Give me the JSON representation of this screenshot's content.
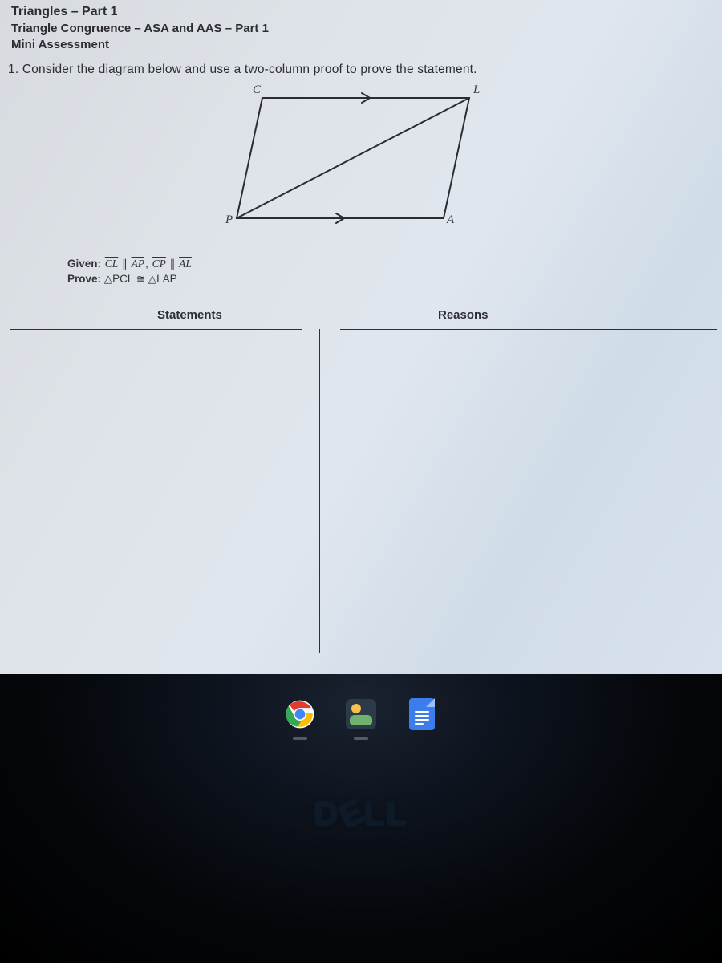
{
  "header": {
    "title": "Triangles – Part 1",
    "subtitle": "Triangle Congruence – ASA and AAS – Part 1",
    "assessment": "Mini Assessment"
  },
  "question": {
    "number": "1.",
    "text": "Consider the diagram below and use a two-column proof to prove the statement."
  },
  "diagram": {
    "vertices": {
      "C": "C",
      "L": "L",
      "P": "P",
      "A": "A"
    }
  },
  "proof_setup": {
    "given_label": "Given:",
    "given_seg1a": "CL",
    "given_rel1": " ∥ ",
    "given_seg1b": "AP",
    "given_sep": ", ",
    "given_seg2a": "CP",
    "given_rel2": " ∥ ",
    "given_seg2b": "AL",
    "prove_label": "Prove:",
    "prove_text_pre": " △PCL ≅ △LAP"
  },
  "table": {
    "col_statements": "Statements",
    "col_reasons": "Reasons"
  },
  "bezel": {
    "brand": "DELL"
  }
}
